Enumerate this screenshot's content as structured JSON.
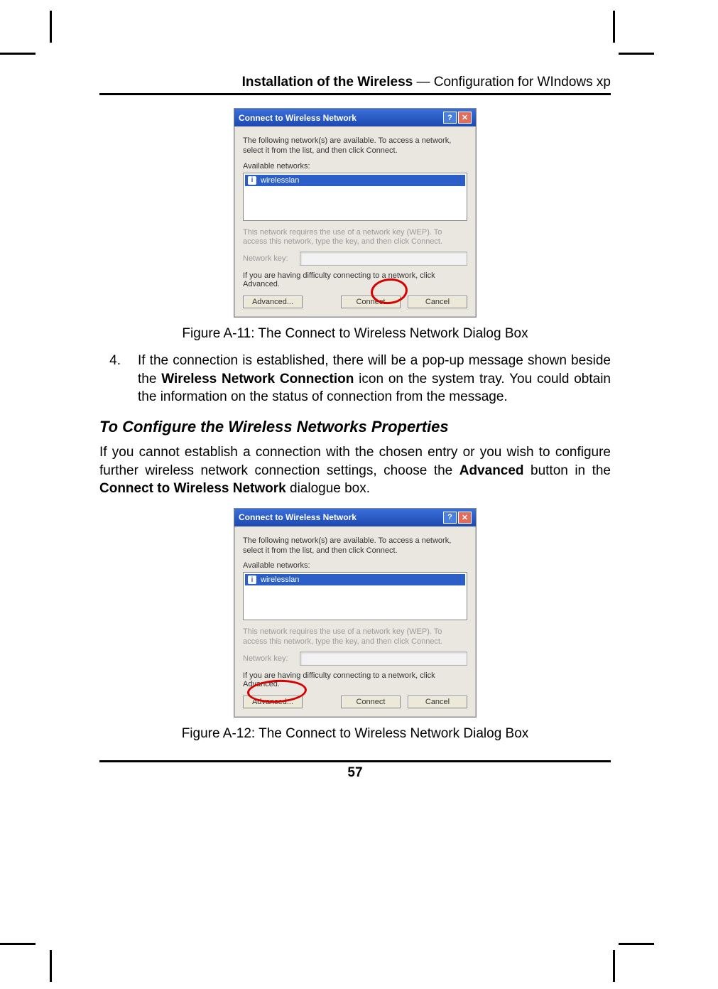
{
  "header": {
    "bold": "Installation of the Wireless",
    "rest": " — Configuration for WIndows xp"
  },
  "dialog": {
    "title": "Connect to Wireless Network",
    "help_glyph": "?",
    "close_glyph": "✕",
    "intro": "The following network(s) are available. To access a network, select it from the list, and then click Connect.",
    "available_label": "Available networks:",
    "network_item": "wirelesslan",
    "wep_text": "This network requires the use of a network key (WEP). To access this network, type the key, and then click Connect.",
    "key_label": "Network key:",
    "difficulty_text": "If you are having difficulty connecting to a network, click Advanced.",
    "buttons": {
      "advanced": "Advanced...",
      "connect": "Connect",
      "cancel": "Cancel"
    }
  },
  "caption1": "Figure A-11: The Connect to Wireless Network Dialog Box",
  "step4": {
    "num": "4.",
    "text_prefix": "If the connection is established, there will be a pop-up message shown beside the ",
    "bold": "Wireless Network Connection",
    "text_suffix": " icon on the system tray. You could obtain the information on the status of connection from the message."
  },
  "subhead": "To Configure the Wireless Networks Properties",
  "para": {
    "p1": "If you cannot establish a connection with the chosen entry or you wish to configure further wireless network connection settings, choose the ",
    "b1": "Advanced",
    "p2": " button in the ",
    "b2": "Connect to Wireless Network",
    "p3": " dialogue box."
  },
  "caption2": "Figure A-12: The Connect to Wireless Network Dialog Box",
  "page_number": "57"
}
